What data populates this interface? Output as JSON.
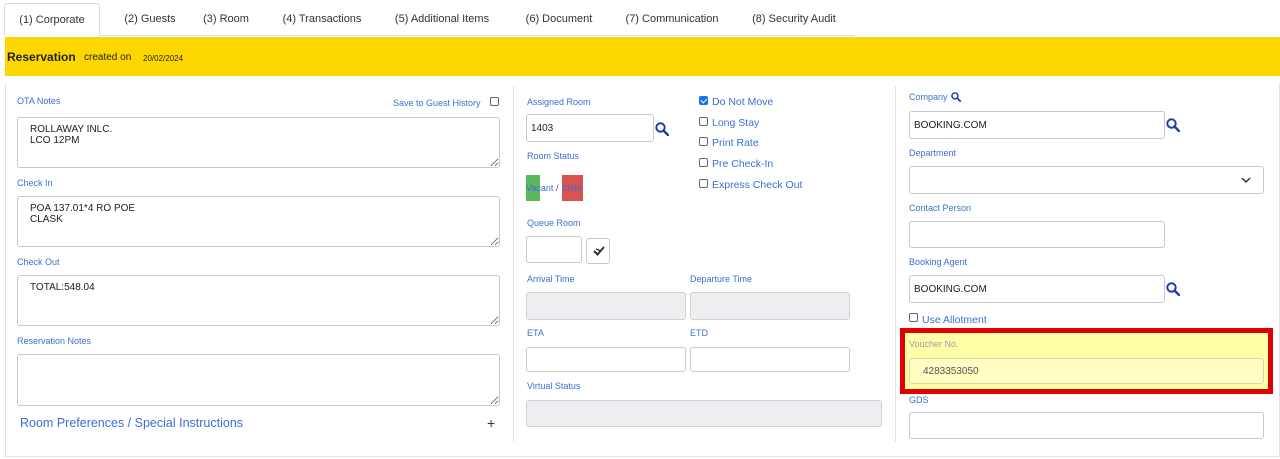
{
  "tabs": [
    {
      "label": "(1) Corporate",
      "active": true
    },
    {
      "label": "(2) Guests"
    },
    {
      "label": "(3) Room"
    },
    {
      "label": "(4) Transactions"
    },
    {
      "label": "(5) Additional Items"
    },
    {
      "label": "(6) Document"
    },
    {
      "label": "(7) Communication"
    },
    {
      "label": "(8) Security Audit"
    }
  ],
  "reservation": {
    "title": "Reservation",
    "created_label": "created on",
    "created_date": "20/02/2024"
  },
  "left": {
    "ota_notes_label": "OTA Notes",
    "save_history_label": "Save to Guest History",
    "ota_notes_value": "ROLLAWAY INLC.\nLCO 12PM",
    "check_in_label": "Check In",
    "check_in_value": "POA 137.01*4 RO POE\nCLASK",
    "check_out_label": "Check Out",
    "check_out_value": "TOTAL:548.04",
    "res_notes_label": "Reservation Notes",
    "res_notes_value": "",
    "pref_label": "Room Preferences / Special Instructions",
    "pref_plus": "+"
  },
  "middle": {
    "assigned_room_label": "Assigned Room",
    "assigned_room_value": "1403",
    "room_status_label": "Room Status",
    "status_vacant": "Vacant",
    "status_sep": "/",
    "status_dirty": "Dirty",
    "status_vacant_color": "#5cb85c",
    "status_dirty_color": "#d9534f",
    "queue_room_label": "Queue Room",
    "arrival_time_label": "Arrival Time",
    "departure_time_label": "Departure Time",
    "eta_label": "ETA",
    "etd_label": "ETD",
    "virtual_status_label": "Virtual Status",
    "checks": [
      {
        "label": "Do Not Move",
        "checked": true
      },
      {
        "label": "Long Stay",
        "checked": false
      },
      {
        "label": "Print Rate",
        "checked": false
      },
      {
        "label": "Pre Check-In",
        "checked": false
      },
      {
        "label": "Express Check Out",
        "checked": false
      }
    ]
  },
  "right": {
    "company_label": "Company",
    "company_value": "BOOKING.COM",
    "department_label": "Department",
    "department_value": "",
    "contact_person_label": "Contact Person",
    "booking_agent_label": "Booking Agent",
    "booking_agent_value": "BOOKING.COM",
    "use_allotment_label": "Use Allotment",
    "voucher_label": "Voucher No.",
    "voucher_value": "4283353050",
    "gds_label": "GDS"
  },
  "colors": {
    "accent": "#3b6fd4",
    "header_yellow": "#ffd700",
    "highlight_red": "#e10000",
    "highlight_fill": "#ffffa8"
  }
}
